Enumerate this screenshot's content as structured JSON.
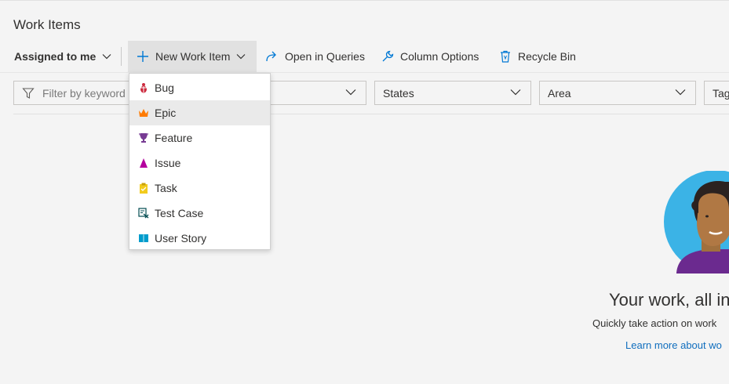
{
  "page": {
    "title": "Work Items"
  },
  "toolbar": {
    "assigned": "Assigned to me",
    "new_item": "New Work Item",
    "open_queries": "Open in Queries",
    "column_options": "Column Options",
    "recycle_bin": "Recycle Bin"
  },
  "filters": {
    "keyword_placeholder": "Filter by keyword",
    "states": "States",
    "area": "Area",
    "tags": "Tags"
  },
  "new_item_menu": {
    "items": [
      {
        "label": "Bug",
        "icon": "bug-icon",
        "color": "#cc293d"
      },
      {
        "label": "Epic",
        "icon": "crown-icon",
        "color": "#ff7b00"
      },
      {
        "label": "Feature",
        "icon": "trophy-icon",
        "color": "#773b93"
      },
      {
        "label": "Issue",
        "icon": "warning-icon",
        "color": "#b4009e"
      },
      {
        "label": "Task",
        "icon": "clipboard-icon",
        "color": "#f2cb1d"
      },
      {
        "label": "Test Case",
        "icon": "test-case-icon",
        "color": "#004b50"
      },
      {
        "label": "User Story",
        "icon": "book-icon",
        "color": "#009ccc"
      }
    ],
    "hovered": "Epic"
  },
  "empty_state": {
    "title": "Your work, all in",
    "subtitle": "Quickly take action on work",
    "link": "Learn more about wo"
  },
  "colors": {
    "accent": "#0078d4",
    "link": "#106ebe",
    "background": "#f4f4f4"
  }
}
